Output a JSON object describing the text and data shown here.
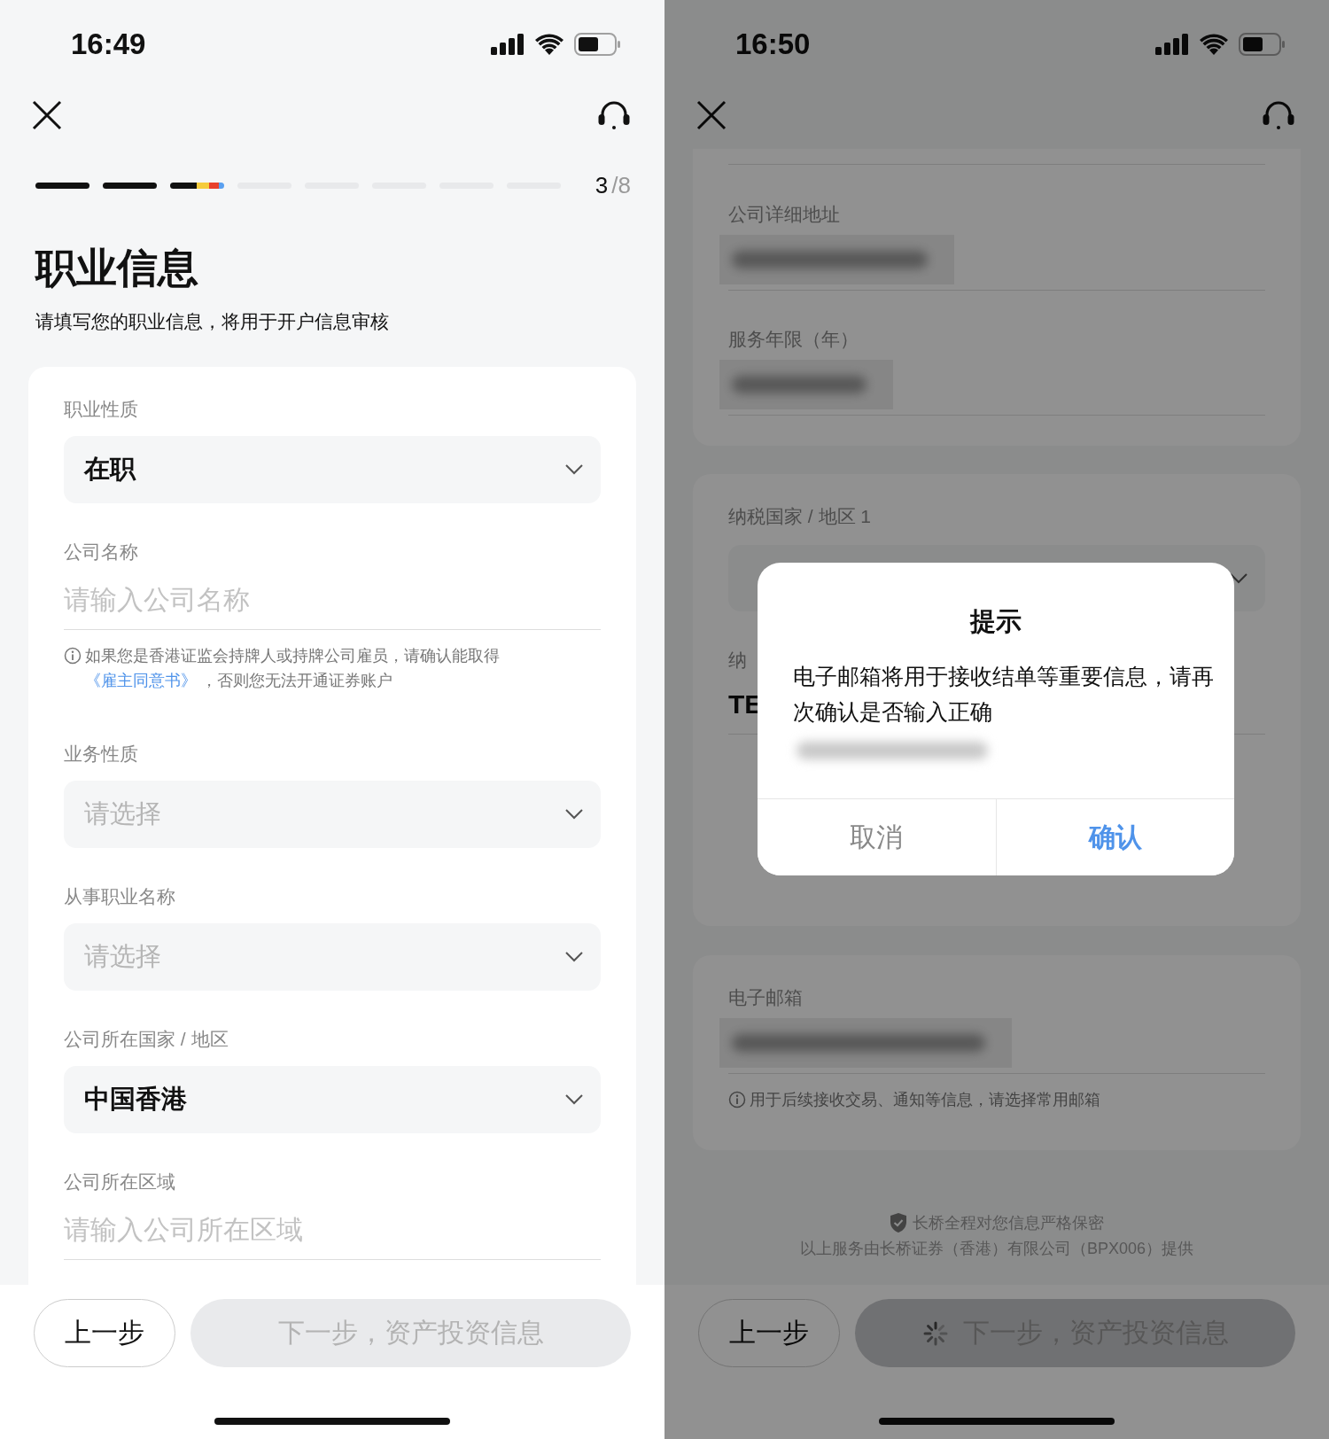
{
  "left_screen": {
    "status_bar": {
      "time": "16:49"
    },
    "progress": {
      "segments": [
        {
          "kind": "done"
        },
        {
          "kind": "done"
        },
        {
          "kind": "current"
        },
        {
          "kind": "todo"
        },
        {
          "kind": "todo"
        },
        {
          "kind": "todo"
        },
        {
          "kind": "todo"
        },
        {
          "kind": "todo"
        }
      ],
      "current": "3",
      "total": "/8"
    },
    "title": "职业信息",
    "subtitle": "请填写您的职业信息，将用于开户信息审核",
    "fields": [
      {
        "kind": "select",
        "label": "职业性质",
        "value": "在职"
      },
      {
        "kind": "text",
        "label": "公司名称",
        "placeholder": "请输入公司名称",
        "note": {
          "before": "如果您是香港证监会持牌人或持牌公司雇员，请确认能取得 ",
          "link": "《雇主同意书》",
          "after": " ，否则您无法开通证券账户"
        }
      },
      {
        "kind": "select",
        "label": "业务性质",
        "placeholder": "请选择"
      },
      {
        "kind": "select",
        "label": "从事职业名称",
        "placeholder": "请选择"
      },
      {
        "kind": "select",
        "label": "公司所在国家 / 地区",
        "value": "中国香港"
      },
      {
        "kind": "text",
        "label": "公司所在区域",
        "placeholder": "请输入公司所在区域"
      }
    ],
    "buttons": {
      "back": "上一步",
      "next": "下一步，资产投资信息",
      "loading": false
    }
  },
  "right_screen": {
    "status_bar": {
      "time": "16:50"
    },
    "cards": [
      {
        "fields": [
          {
            "kind": "redacted",
            "label": "公司详细地址"
          },
          {
            "kind": "redacted",
            "label": "服务年限（年）"
          }
        ]
      },
      {
        "fields": [
          {
            "kind": "select",
            "label": "纳税国家 / 地区 1"
          },
          {
            "kind": "text",
            "label": "纳",
            "value": "TE"
          }
        ]
      },
      {
        "fields": [
          {
            "kind": "redacted",
            "label": "电子邮箱",
            "note": {
              "before": "用于后续接收交易、通知等信息，请选择常用邮箱"
            }
          }
        ]
      }
    ],
    "footer": {
      "secure_note": "长桥全程对您信息严格保密",
      "provider": "以上服务由长桥证券（香港）有限公司（BPX006）提供"
    },
    "buttons": {
      "back": "上一步",
      "next": "下一步，资产投资信息",
      "loading": true
    },
    "dialog": {
      "title": "提示",
      "message": "电子邮箱将用于接收结单等重要信息，请再次确认是否输入正确",
      "buttons": [
        {
          "label": "取消",
          "kind": "cancel"
        },
        {
          "label": "确认",
          "kind": "confirm"
        }
      ]
    }
  }
}
